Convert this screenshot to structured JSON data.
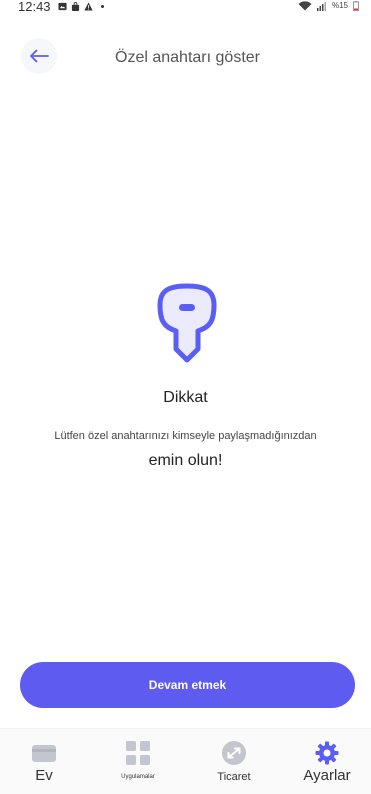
{
  "status_bar": {
    "time": "12:43",
    "battery": "%15"
  },
  "header": {
    "title": "Özel anahtarı göster"
  },
  "warning": {
    "title": "Dikkat",
    "line1": "Lütfen özel anahtarınızı kimseyle paylaşmadığınızdan",
    "line2": "emin olun!"
  },
  "primary_button": {
    "label": "Devam etmek"
  },
  "bottom_nav": {
    "items": [
      {
        "label": "Ev",
        "icon": "wallet-icon",
        "active": false
      },
      {
        "label": "Uygulamalar",
        "icon": "grid-icon",
        "active": false
      },
      {
        "label": "Ticaret",
        "icon": "swap-icon",
        "active": false
      },
      {
        "label": "Ayarlar",
        "icon": "gear-icon",
        "active": true
      }
    ]
  },
  "colors": {
    "accent": "#5d5bf0",
    "active_icon": "#5b5ef5",
    "inactive_icon": "#c4c6cf",
    "key_fill": "#eceafd",
    "key_stroke": "#5b5ef5"
  }
}
